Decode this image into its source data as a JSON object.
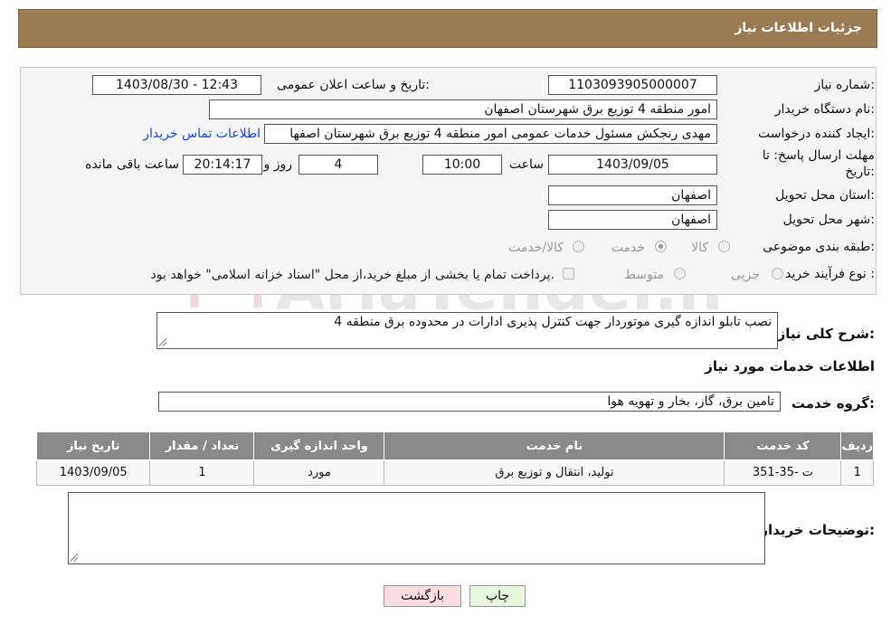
{
  "header": {
    "title": "جزئیات اطلاعات نیاز"
  },
  "form": {
    "need_number": {
      "label": "شماره نیاز:",
      "value": "1103093905000007"
    },
    "announce_datetime": {
      "label": "تاریخ و ساعت اعلان عمومی:",
      "value": "1403/08/30 - 12:43"
    },
    "buyer_org": {
      "label": "نام دستگاه خریدار:",
      "value": "امور منطقه 4 توزیع برق شهرستان اصفهان"
    },
    "requester": {
      "label": "ایجاد کننده درخواست:",
      "value": "مهدی رنجکش مسئول خدمات عمومی امور منطقه 4 توزیع برق شهرستان اصفها",
      "contact_link": "اطلاعات تماس خریدار"
    },
    "deadline": {
      "label_line1": "مهلت ارسال پاسخ: تا",
      "label_line2": "تاریخ:",
      "date": "1403/09/05",
      "time_label": "ساعت",
      "time": "10:00",
      "days": "4",
      "days_label": "روز و",
      "remaining": "20:14:17",
      "remaining_label": "ساعت باقی مانده"
    },
    "province": {
      "label": "استان محل تحویل:",
      "value": "اصفهان"
    },
    "city": {
      "label": "شهر محل تحویل:",
      "value": "اصفهان"
    },
    "category": {
      "label": "طبقه بندی موضوعی:",
      "options": [
        "کالا",
        "خدمت",
        "کالا/خدمت"
      ],
      "selected": "خدمت"
    },
    "purchase_type": {
      "label": "نوع فرآیند خرید :",
      "options": [
        "جزیی",
        "متوسط"
      ],
      "payment_note": "پرداخت تمام یا بخشی از مبلغ خرید،از محل \"اسناد خزانه اسلامی\" خواهد بود."
    }
  },
  "description": {
    "label": "شرح کلی نیاز:",
    "value": "نصب تابلو اندازه گیری موتوردار جهت کنترل پذیری ادارات در محدوده برق منطقه 4"
  },
  "services_section": {
    "title": "اطلاعات خدمات مورد نیاز",
    "group_label": "گروه خدمت:",
    "group_value": "تامین برق، گاز، بخار و تهویه هوا"
  },
  "table": {
    "headers": [
      "ردیف",
      "کد خدمت",
      "نام خدمت",
      "واحد اندازه گیری",
      "تعداد / مقدار",
      "تاریخ نیاز"
    ],
    "rows": [
      [
        "1",
        "ت -35-351",
        "تولید، انتقال و توزیع برق",
        "مورد",
        "1",
        "1403/09/05"
      ]
    ]
  },
  "buyer_notes": {
    "label": "توضیحات خریدار:",
    "value": ""
  },
  "buttons": {
    "print": "چاپ",
    "back": "بازگشت"
  },
  "colors": {
    "header": "#9b7b52",
    "table_header": "#8a8a8a",
    "back_button": "#f8dede",
    "print_button": "#e6f7de"
  }
}
